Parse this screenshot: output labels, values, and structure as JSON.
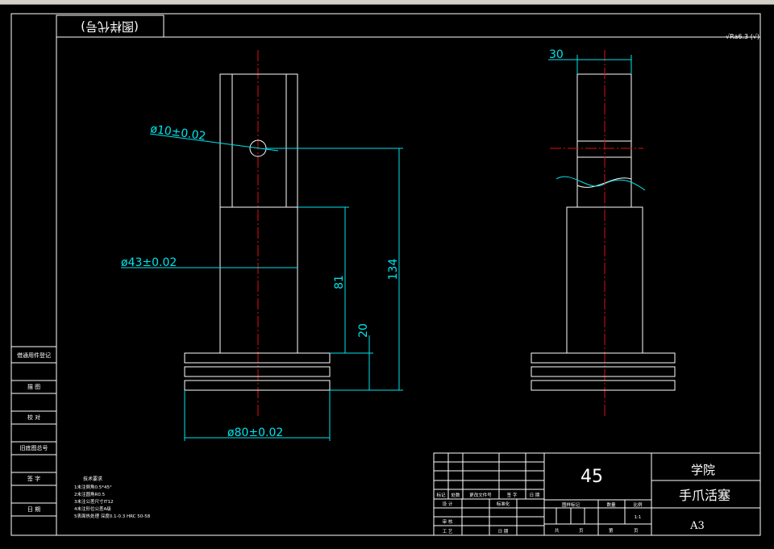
{
  "drawing_code_label": "(图样代号)",
  "roughness": "√Ra6.3 (√)",
  "front_view": {
    "dim_hole": "ø10±0.02",
    "dim_shaft": "ø43±0.02",
    "dim_flange": "ø80±0.02",
    "dim_81": "81",
    "dim_134": "134",
    "dim_20": "20"
  },
  "side_view": {
    "dim_30": "30"
  },
  "left_column": [
    "借通用件登记",
    "描 图",
    "校 对",
    "旧底图总号",
    "签 字",
    "日 期"
  ],
  "notes": {
    "title": "技术要求",
    "lines": [
      "1未注倒角0.5*45°",
      "2未注圆角R0.5",
      "3未注公差尺寸IT12",
      "4未注形位公差A级",
      "5表面热处理 深度0.1-0.3 HRC 50-58"
    ]
  },
  "title_block": {
    "material": "45",
    "school": "学院",
    "part_name": "手爪活塞",
    "sheet_size": "A3",
    "rev_headers": [
      "标记",
      "处数",
      "更改文件号",
      "签 字",
      "日 期"
    ],
    "design": "设 计",
    "standardize": "标准化",
    "review": "审 核",
    "process": "工 艺",
    "date": "日 期",
    "stage_mark": "图样标记",
    "weight": "数量",
    "scale": "比例",
    "scale_value": "1:1",
    "total": "共",
    "sheet": "页",
    "no": "第",
    "sheet2": "页"
  }
}
